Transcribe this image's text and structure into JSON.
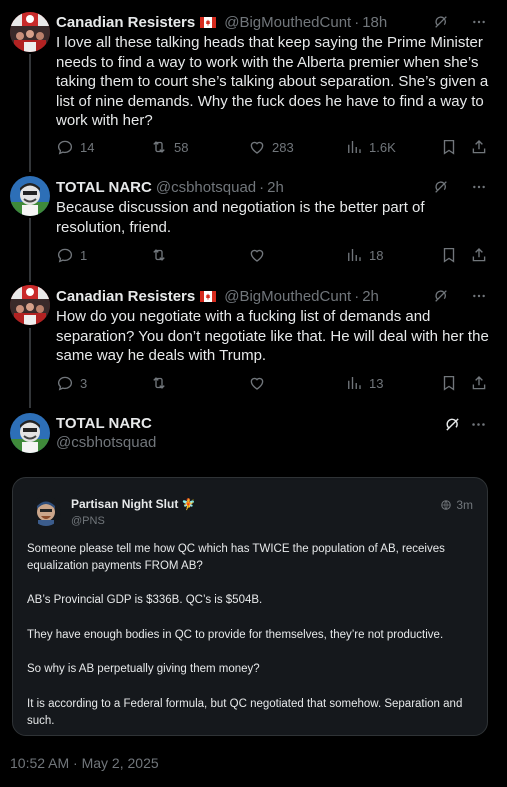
{
  "tweets": [
    {
      "name": "Canadian Resisters",
      "handle": "@BigMouthedCunt",
      "time": "18h",
      "text": "I love all these talking heads that keep saying the Prime Minister needs to find a way to work with the Alberta premier when she’s taking them to court she’s talking about separation. She’s given a list of nine demands. Why the fuck does he have to find a way to work with her?",
      "replies": "14",
      "reposts": "58",
      "likes": "283",
      "views": "1.6K"
    },
    {
      "name": "TOTAL NARC",
      "handle": "@csbhotsquad",
      "time": "2h",
      "text": "Because discussion and negotiation is the better part of resolution, friend.",
      "replies": "1",
      "reposts": "",
      "likes": "",
      "views": "18"
    },
    {
      "name": "Canadian Resisters",
      "handle": "@BigMouthedCunt",
      "time": "2h",
      "text": "How do you negotiate with a fucking list of demands and separation? You don’t negotiate like that. He will deal with her the same way he deals with Trump.",
      "replies": "3",
      "reposts": "",
      "likes": "",
      "views": "13"
    }
  ],
  "main_tweet": {
    "name": "TOTAL NARC",
    "handle": "@csbhotsquad",
    "timestamp": "10:52 AM · May 2, 2025"
  },
  "quote": {
    "name": "Partisan Night Slut",
    "handle": "@PNS",
    "time": "3m",
    "paragraphs": [
      "Someone please tell me how QC which has TWICE the population of AB,  receives equalization payments FROM AB?",
      "AB’s Provincial GDP is $336B. QC’s is $504B.",
      "They have enough bodies in QC to provide for themselves, they’re not productive.",
      "So why is AB perpetually giving them money?",
      "It is according to a Federal formula, but QC negotiated that somehow. Separation and such."
    ]
  },
  "colors": {
    "background": "#000000",
    "text": "#e7e9ea",
    "muted": "#71767b",
    "card": "#15181c",
    "border": "#2f3336"
  },
  "icons": [
    "reply-icon",
    "repost-icon",
    "like-icon",
    "views-icon",
    "bookmark-icon",
    "share-icon",
    "grok-icon",
    "more-icon",
    "globe-icon",
    "flag-icon"
  ]
}
